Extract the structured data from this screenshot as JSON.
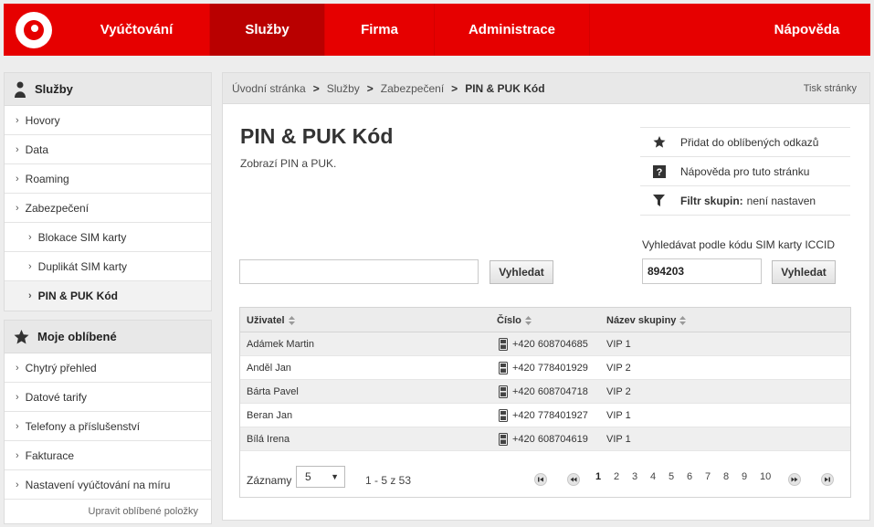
{
  "nav": {
    "items": [
      {
        "label": "Vyúčtování",
        "active": false
      },
      {
        "label": "Služby",
        "active": true
      },
      {
        "label": "Firma",
        "active": false
      },
      {
        "label": "Administrace",
        "active": false
      },
      {
        "label": "Nápověda",
        "active": false
      }
    ]
  },
  "sidebar": {
    "services": {
      "title": "Služby",
      "items": [
        {
          "label": "Hovory"
        },
        {
          "label": "Data"
        },
        {
          "label": "Roaming"
        },
        {
          "label": "Zabezpečení"
        },
        {
          "label": "Blokace SIM karty"
        },
        {
          "label": "Duplikát SIM karty"
        },
        {
          "label": "PIN & PUK Kód"
        }
      ]
    },
    "favorites": {
      "title": "Moje oblíbené",
      "items": [
        {
          "label": "Chytrý přehled"
        },
        {
          "label": "Datové tarify"
        },
        {
          "label": "Telefony a příslušenství"
        },
        {
          "label": "Fakturace"
        },
        {
          "label": "Nastavení vyúčtování na míru"
        }
      ],
      "edit_label": "Upravit oblíbené položky"
    }
  },
  "breadcrumb": {
    "items": [
      "Úvodní stránka",
      "Služby",
      "Zabezpečení"
    ],
    "current": "PIN & PUK Kód",
    "separator": ">",
    "print_label": "Tisk stránky"
  },
  "page": {
    "title": "PIN & PUK Kód",
    "description": "Zobrazí PIN a PUK."
  },
  "actions": {
    "add_favorite": "Přidat do oblíbených odkazů",
    "help": "Nápověda pro tuto stránku",
    "filter_label": "Filtr skupin:",
    "filter_value": "není nastaven"
  },
  "search": {
    "value": "",
    "button": "Vyhledat"
  },
  "iccid": {
    "label": "Vyhledávat podle kódu SIM karty ICCID",
    "value": "894203",
    "button": "Vyhledat"
  },
  "table": {
    "columns": [
      "Uživatel",
      "Číslo",
      "Název skupiny"
    ],
    "rows": [
      {
        "user": "Adámek Martin",
        "number": "+420 608704685",
        "group": "VIP 1"
      },
      {
        "user": "Anděl Jan",
        "number": "+420 778401929",
        "group": "VIP 2"
      },
      {
        "user": "Bárta Pavel",
        "number": "+420 608704718",
        "group": "VIP 2"
      },
      {
        "user": "Beran Jan",
        "number": "+420 778401927",
        "group": "VIP 1"
      },
      {
        "user": "Bílá Irena",
        "number": "+420 608704619",
        "group": "VIP 1"
      }
    ]
  },
  "pagination": {
    "records_label": "Záznamy",
    "records_value": "5",
    "range": "1 - 5 z 53",
    "pages": [
      "1",
      "2",
      "3",
      "4",
      "5",
      "6",
      "7",
      "8",
      "9",
      "10"
    ],
    "current_page": "1"
  },
  "colors": {
    "brand_red": "#e60000",
    "active_nav": "#b90000"
  }
}
